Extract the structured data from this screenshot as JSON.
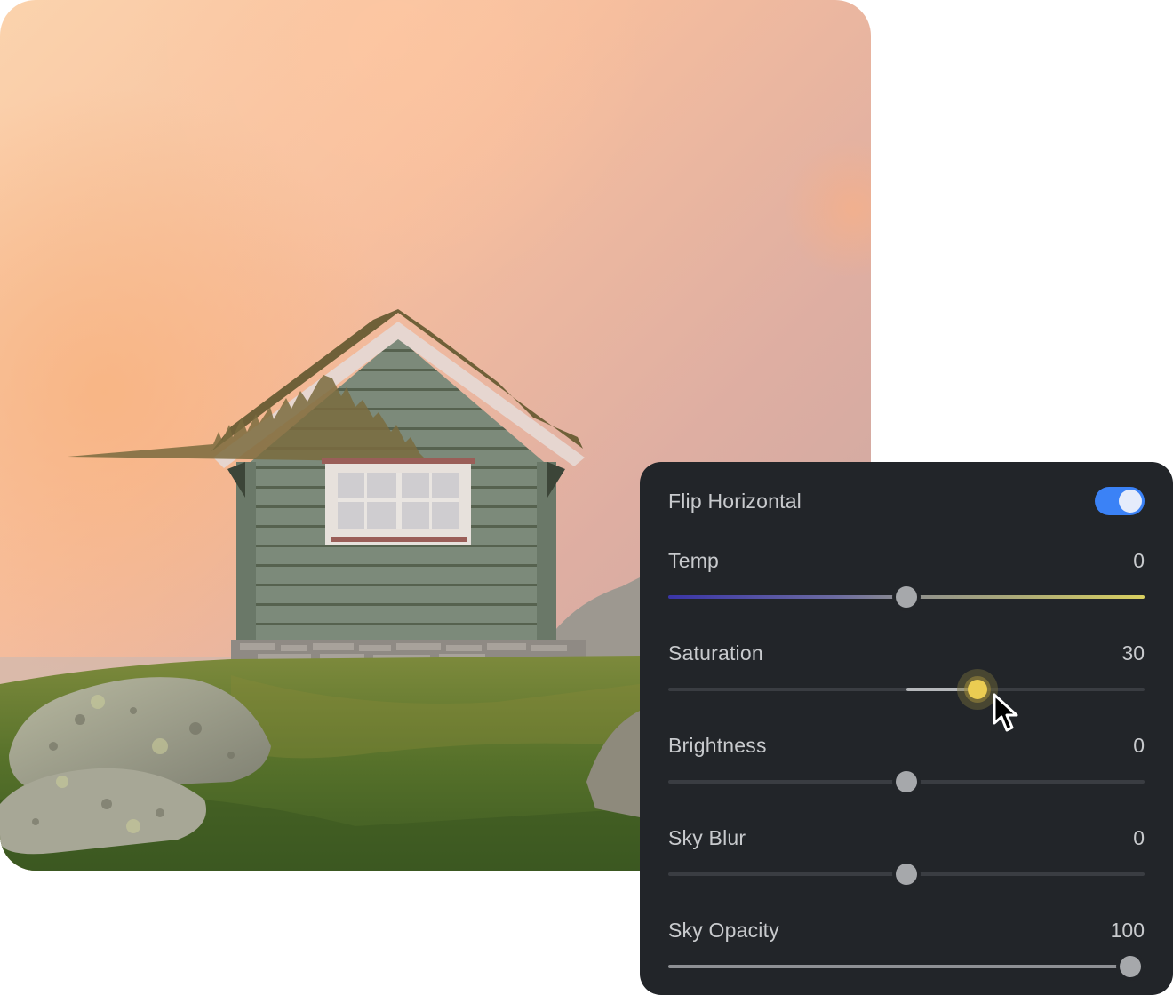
{
  "photo": {
    "subject": "house-photo",
    "sky_colors": [
      "#f8c9a0",
      "#f2b59a",
      "#d9a9a2",
      "#c2a5a5"
    ],
    "siding_color": "#7c8a7a",
    "grass_color": "#5d7a2e"
  },
  "panel": {
    "background": "#222529",
    "flip": {
      "label": "Flip Horizontal",
      "enabled": true,
      "accent": "#3b82f6"
    },
    "controls": [
      {
        "id": "temp",
        "label": "Temp",
        "value": "0",
        "min": -100,
        "max": 100,
        "current": 0,
        "style": "gradient"
      },
      {
        "id": "saturation",
        "label": "Saturation",
        "value": "30",
        "min": -100,
        "max": 100,
        "current": 30,
        "style": "fill-from-center",
        "active": true
      },
      {
        "id": "brightness",
        "label": "Brightness",
        "value": "0",
        "min": -100,
        "max": 100,
        "current": 0,
        "style": "plain"
      },
      {
        "id": "sky-blur",
        "label": "Sky Blur",
        "value": "0",
        "min": -100,
        "max": 100,
        "current": 0,
        "style": "plain"
      },
      {
        "id": "sky-opacity",
        "label": "Sky Opacity",
        "value": "100",
        "min": 0,
        "max": 100,
        "current": 100,
        "style": "full"
      }
    ],
    "active_thumb_color": "#ebcc52"
  }
}
